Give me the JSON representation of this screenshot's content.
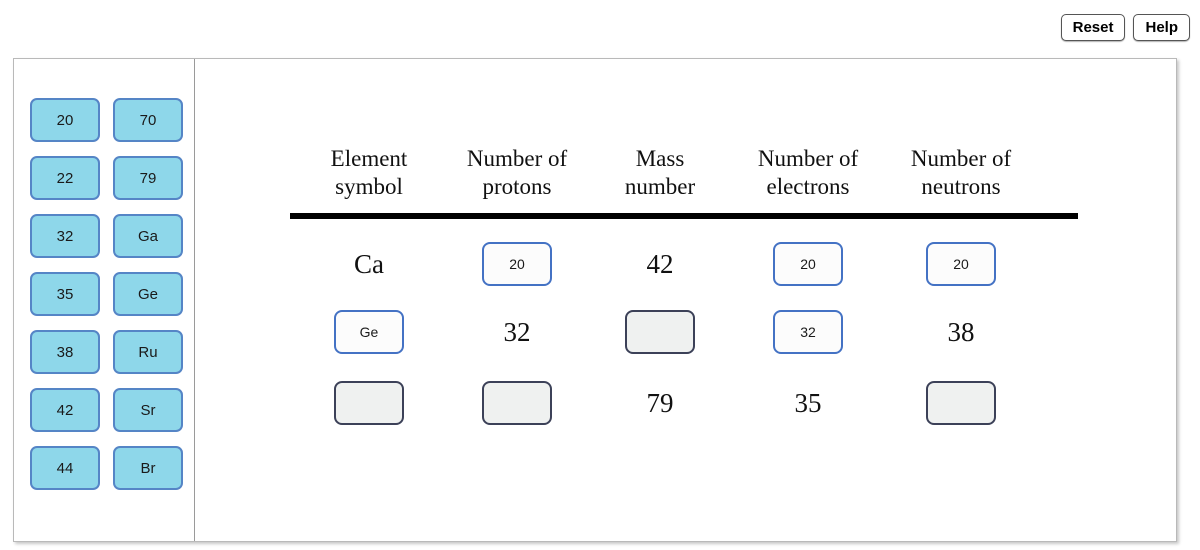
{
  "toolbar": {
    "reset_label": "Reset",
    "help_label": "Help"
  },
  "tile_bank": {
    "tiles": [
      {
        "label": "20"
      },
      {
        "label": "70"
      },
      {
        "label": "22"
      },
      {
        "label": "79"
      },
      {
        "label": "32"
      },
      {
        "label": "Ga"
      },
      {
        "label": "35"
      },
      {
        "label": "Ge"
      },
      {
        "label": "38"
      },
      {
        "label": "Ru"
      },
      {
        "label": "42"
      },
      {
        "label": "Sr"
      },
      {
        "label": "44"
      },
      {
        "label": "Br"
      }
    ]
  },
  "table": {
    "headers": [
      {
        "line1": "Element",
        "line2": "symbol"
      },
      {
        "line1": "Number of",
        "line2": "protons"
      },
      {
        "line1": "Mass",
        "line2": "number"
      },
      {
        "line1": "Number of",
        "line2": "electrons"
      },
      {
        "line1": "Number of",
        "line2": "neutrons"
      }
    ],
    "rows": [
      {
        "cells": [
          {
            "kind": "static",
            "value": "Ca"
          },
          {
            "kind": "filled",
            "value": "20"
          },
          {
            "kind": "static",
            "value": "42"
          },
          {
            "kind": "filled",
            "value": "20"
          },
          {
            "kind": "filled",
            "value": "20"
          }
        ]
      },
      {
        "cells": [
          {
            "kind": "filled",
            "value": "Ge"
          },
          {
            "kind": "static",
            "value": "32"
          },
          {
            "kind": "empty",
            "value": ""
          },
          {
            "kind": "filled",
            "value": "32"
          },
          {
            "kind": "static",
            "value": "38"
          }
        ]
      },
      {
        "cells": [
          {
            "kind": "empty",
            "value": ""
          },
          {
            "kind": "empty",
            "value": ""
          },
          {
            "kind": "static",
            "value": "79"
          },
          {
            "kind": "static",
            "value": "35"
          },
          {
            "kind": "empty",
            "value": ""
          }
        ]
      }
    ]
  },
  "colors": {
    "tile_fill": "#8ed7ea",
    "tile_border": "#5585c6",
    "filled_border": "#4472c4",
    "empty_fill": "#eff1f0",
    "empty_border": "#3c4158",
    "rule": "#000000"
  }
}
